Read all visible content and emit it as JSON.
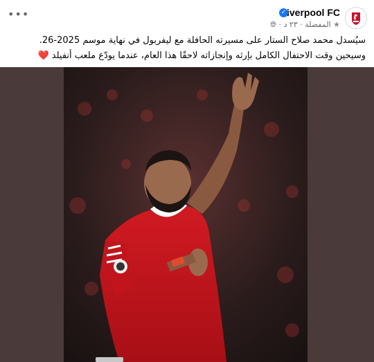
{
  "post": {
    "page_name": "Liverpool FC",
    "meta": {
      "favorite_label": "المفضلة",
      "separator": "·",
      "time": "٢٣ د",
      "audience_icon": "globe-icon",
      "favorite_icon": "star-icon"
    },
    "caption_lines": [
      "سيُسدل محمد صلاح الستار على مسيرته الحافلة مع ليفربول في نهاية موسم 2025-26.",
      "وسيحين وقت الاحتفال الكامل بإرثه وإنجازاته لاحقًا هذا العام، عندما يودّع ملعب أنفيلد"
    ],
    "caption_emoji": "❤️",
    "more_icon": "•••",
    "colors": {
      "brand_red": "#c8102e",
      "verified_blue": "#1877f2",
      "media_backdrop": "#4a3b3a"
    }
  }
}
